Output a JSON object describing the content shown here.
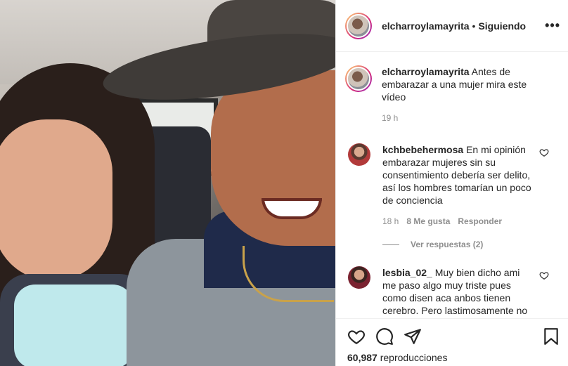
{
  "header": {
    "username": "elcharroylamayrita",
    "separator": "•",
    "follow_status": "Siguiendo",
    "more_label": "•••"
  },
  "caption": {
    "username": "elcharroylamayrita",
    "text": "Antes de embarazar a una mujer mira este vídeo",
    "time": "19 h"
  },
  "comments": [
    {
      "username": "kchbebehermosa",
      "text": "En mi opinión embarazar mujeres sin su consentimiento debería ser delito, así los hombres tomarían un poco de conciencia",
      "time": "18 h",
      "likes": "8 Me gusta",
      "reply_label": "Responder",
      "avatar_color": "#b23a3a"
    },
    {
      "username": "lesbia_02_",
      "text": "Muy bien dicho ami me paso algo muy triste pues como disen aca anbos tienen cerebro. Pero lastimosamente no",
      "avatar_color": "#7a2230"
    }
  ],
  "view_replies_label": "Ver respuestas (2)",
  "footer": {
    "views_count": "60,987",
    "views_label": "reproducciones"
  },
  "icons": {
    "like": "heart-icon",
    "comment": "comment-icon",
    "share": "share-icon",
    "save": "bookmark-icon",
    "more": "more-options-icon"
  },
  "colors": {
    "text": "#262626",
    "secondary": "#8e8e8e",
    "border": "#efefef"
  }
}
